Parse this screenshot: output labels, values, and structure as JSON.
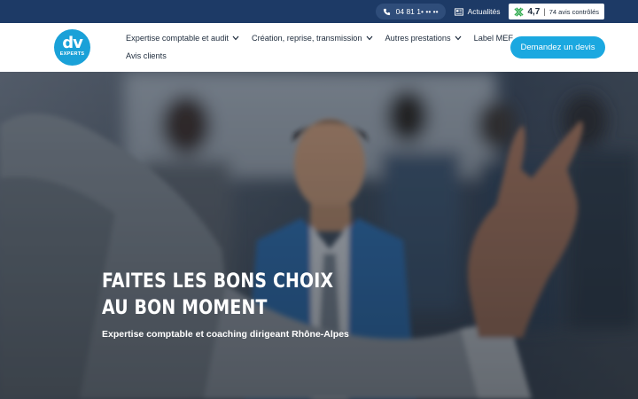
{
  "topbar": {
    "phone": "04 81 1• •• ••",
    "news_label": "Actualités",
    "rating_score": "4,7",
    "rating_separator": "|",
    "rating_count": "74 avis contrôlés",
    "icons": {
      "phone": "phone-icon",
      "news": "newspaper-icon",
      "rating": "review-badge-icon"
    }
  },
  "header": {
    "logo_main": "dv",
    "logo_sub": "EXPERTS",
    "nav": [
      {
        "label": "Expertise comptable et audit",
        "has_dropdown": true
      },
      {
        "label": "Création, reprise, transmission",
        "has_dropdown": true
      },
      {
        "label": "Autres prestations",
        "has_dropdown": true
      },
      {
        "label": "Label MEF",
        "has_dropdown": false
      },
      {
        "label": "Avis clients",
        "has_dropdown": false
      }
    ],
    "cta_label": "Demandez un devis"
  },
  "hero": {
    "title_line1": "FAITES LES BONS CHOIX",
    "title_line2": "AU BON MOMENT",
    "subtitle": "Expertise comptable et coaching dirigeant Rhône-Alpes"
  },
  "colors": {
    "topbar": "#1d3a66",
    "accent": "#1ba8e0",
    "logo": "#1aa1d8",
    "text_dark": "#1d2b3c",
    "rating_green": "#2aa84a"
  }
}
